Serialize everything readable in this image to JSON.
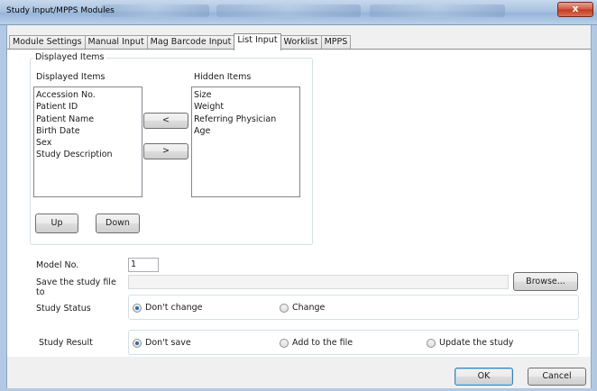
{
  "window": {
    "title": "Study Input/MPPS Modules",
    "close_glyph": "x"
  },
  "tabs": [
    {
      "label": "Module Settings",
      "active": false
    },
    {
      "label": "Manual Input",
      "active": false
    },
    {
      "label": "Mag Barcode Input",
      "active": false
    },
    {
      "label": "List Input",
      "active": true
    },
    {
      "label": "Worklist",
      "active": false
    },
    {
      "label": "MPPS",
      "active": false
    }
  ],
  "displayed_items_group": {
    "legend": "Displayed Items",
    "displayed_label": "Displayed Items",
    "hidden_label": "Hidden Items",
    "displayed": [
      "Accession No.",
      "Patient ID",
      "Patient Name",
      "Birth Date",
      "Sex",
      "Study Description"
    ],
    "hidden": [
      "Size",
      "Weight",
      "Referring Physician",
      "Age"
    ],
    "move_left_label": "<",
    "move_right_label": ">",
    "up_label": "Up",
    "down_label": "Down"
  },
  "model_no": {
    "label": "Model No.",
    "value": "1"
  },
  "save_file": {
    "label": "Save the study file to",
    "value": "",
    "browse_label": "Browse..."
  },
  "study_status": {
    "label": "Study Status",
    "options": [
      {
        "label": "Don't change",
        "selected": true
      },
      {
        "label": "Change",
        "selected": false
      }
    ]
  },
  "study_result": {
    "label": "Study Result",
    "options": [
      {
        "label": "Don't save",
        "selected": true
      },
      {
        "label": "Add to the file",
        "selected": false
      },
      {
        "label": "Update the study",
        "selected": false
      }
    ]
  },
  "footer": {
    "ok_label": "OK",
    "cancel_label": "Cancel"
  }
}
